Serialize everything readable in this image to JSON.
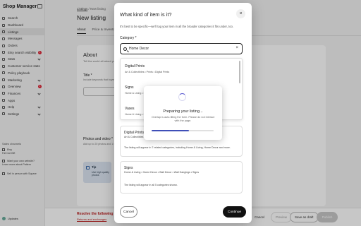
{
  "sidebar": {
    "brand": "Shop Manager",
    "items": [
      {
        "label": "Search",
        "active": false
      },
      {
        "label": "Dashboard",
        "active": false
      },
      {
        "label": "Listings",
        "active": true
      },
      {
        "label": "Messages",
        "active": false
      },
      {
        "label": "Orders",
        "active": false
      },
      {
        "label": "Etsy search visibility",
        "badge": "1"
      },
      {
        "label": "Stats",
        "chev": true
      },
      {
        "label": "Customer service stats",
        "active": false
      },
      {
        "label": "Policy playbook",
        "active": false
      },
      {
        "label": "Marketing",
        "chev": true
      },
      {
        "label": "Overview",
        "badge": "1"
      },
      {
        "label": "Finances",
        "chev": true
      },
      {
        "label": "Apps",
        "active": false
      },
      {
        "label": "Help",
        "chev": true
      },
      {
        "label": "Settings",
        "chev": true
      }
    ],
    "section": "Sales channels",
    "shop_label": "Etsy",
    "shop_sub": "Fat Cat Gift",
    "promo1": "Want your own website? Learn more about Pattern",
    "promo2": "Sell in person with Square",
    "user": "Updates"
  },
  "main": {
    "crumb_link": "Listings",
    "crumb_rest": " / New listing",
    "title": "New listing",
    "tabs": [
      "About",
      "Price & Inventory"
    ],
    "card_heading": "About",
    "card_sub": "Tell the world all about your item",
    "title_label": "Title *",
    "title_sub": "Include keywords that buyers would use to search for this item.",
    "photos_label": "Photos and video *",
    "photos_sub": "Add up to 20 photos and 1 video.",
    "drop_t1": "Tip",
    "drop_t2": "Use high quality photos"
  },
  "footer": {
    "error": "Resolve the following",
    "error_link": "Returns and exchanges",
    "cancel": "Cancel",
    "preview": "Preview",
    "draft": "Save as draft",
    "publish": "Publish"
  },
  "modal": {
    "title": "What kind of item is it?",
    "desc": "It's best to be specific—we'll tag your item in all the broader categories it fits under, too.",
    "category_label": "Category *",
    "search_value": "Home Decor",
    "dropdown": [
      {
        "name": "Digital Prints",
        "path": "Art & Collectibles  •  Prints  •  Digital Prints"
      },
      {
        "name": "Signs",
        "path": "Home & Living  •  Home Decor"
      },
      {
        "name": "Vases",
        "path": "Home & Living  •  Home Decor"
      }
    ],
    "suggestions": [
      {
        "name": "Digital Prints",
        "path": "Art & Collectibles",
        "note": "The listing will appear in 7 related categories, including Home & Living, Home Decor and more."
      },
      {
        "name": "Signs",
        "path": "Home & Living  •  Home Decor  •  Wall Decor  •  Wall Hangings  •  Signs",
        "note": "The listing will appear in all 5 categories shown."
      }
    ],
    "cancel": "Cancel",
    "continue": "Continue"
  },
  "progress": {
    "title": "Preparing your listing...",
    "subtitle": "Overlap is auto-filling the form. Please do not interact with the page.",
    "percent": 60
  }
}
